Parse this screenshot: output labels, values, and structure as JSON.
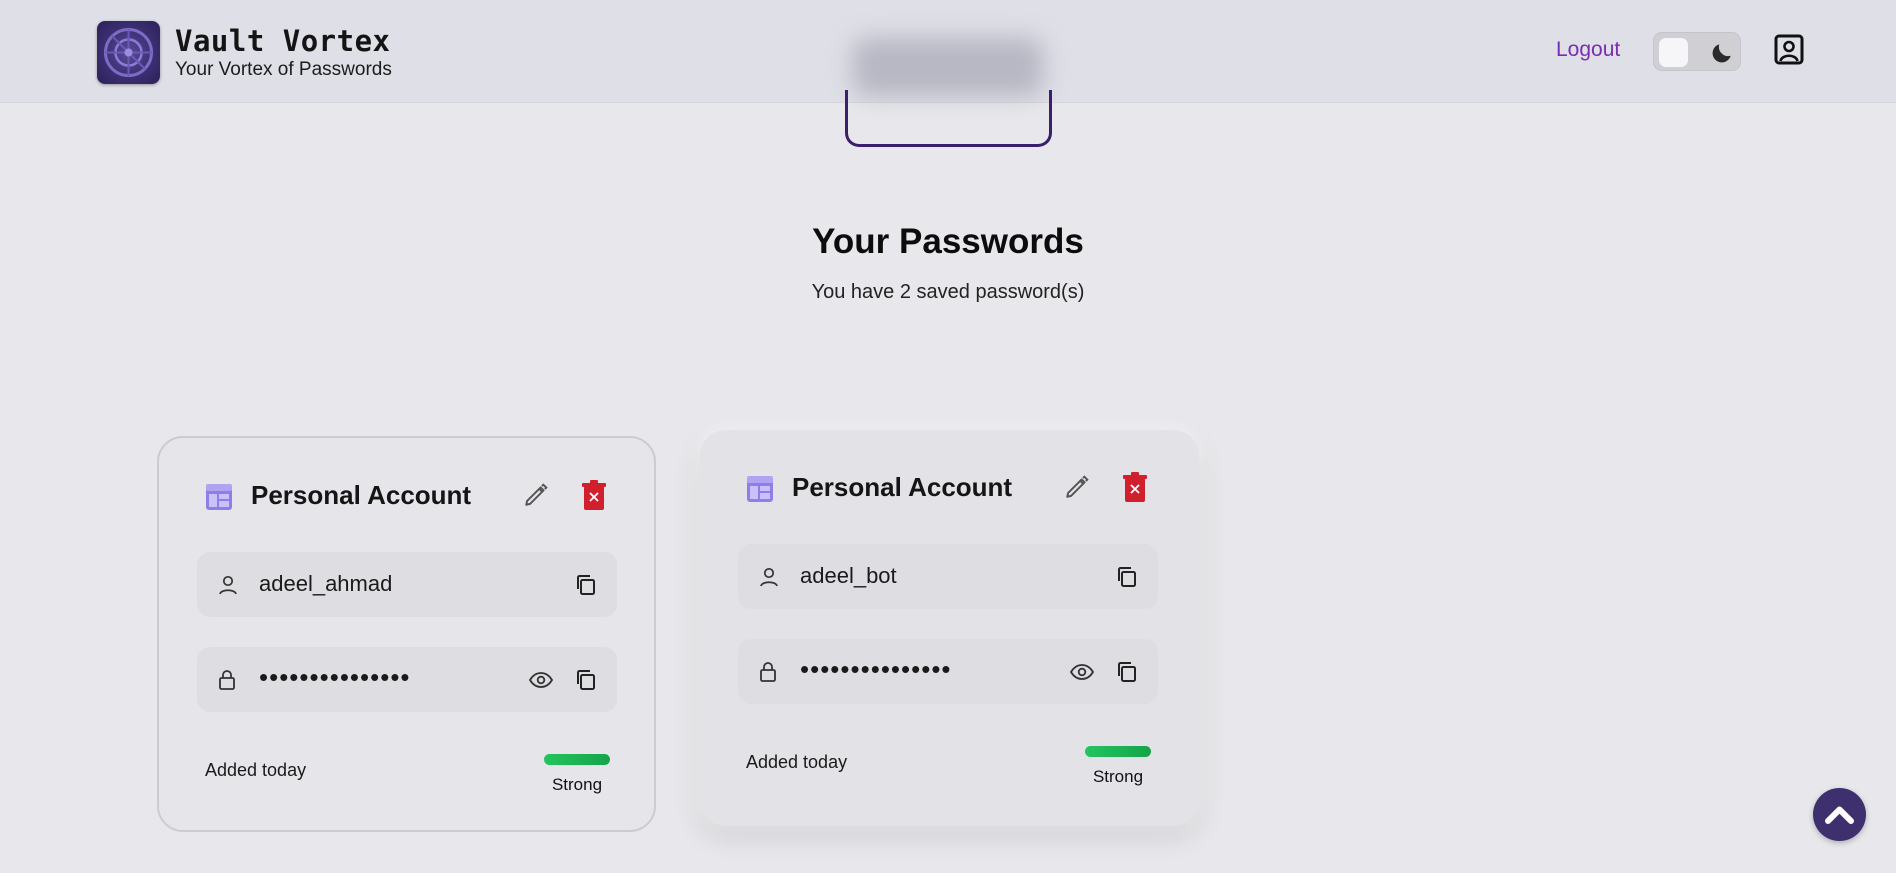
{
  "header": {
    "brand_title": "Vault Vortex",
    "brand_subtitle": "Your Vortex of Passwords",
    "logout_label": "Logout",
    "theme_toggle": {
      "state": "light",
      "icons": [
        "sun-knob",
        "moon-icon"
      ]
    },
    "profile_icon": "user-square-icon"
  },
  "main": {
    "title": "Your Passwords",
    "subtitle": "You have 2 saved password(s)"
  },
  "cards": [
    {
      "title": "Personal Account",
      "username": "adeel_ahmad",
      "password_masked": "•••••••••••••••",
      "added": "Added today",
      "strength_label": "Strong",
      "strength_fraction": 1.0
    },
    {
      "title": "Personal Account",
      "username": "adeel_bot",
      "password_masked": "•••••••••••••••",
      "added": "Added today",
      "strength_label": "Strong",
      "strength_fraction": 1.0
    }
  ],
  "colors": {
    "accent": "#7a2db1",
    "brand_dark": "#3e2f6e",
    "strength_strong": "#22c55e",
    "delete": "#d0202e"
  }
}
